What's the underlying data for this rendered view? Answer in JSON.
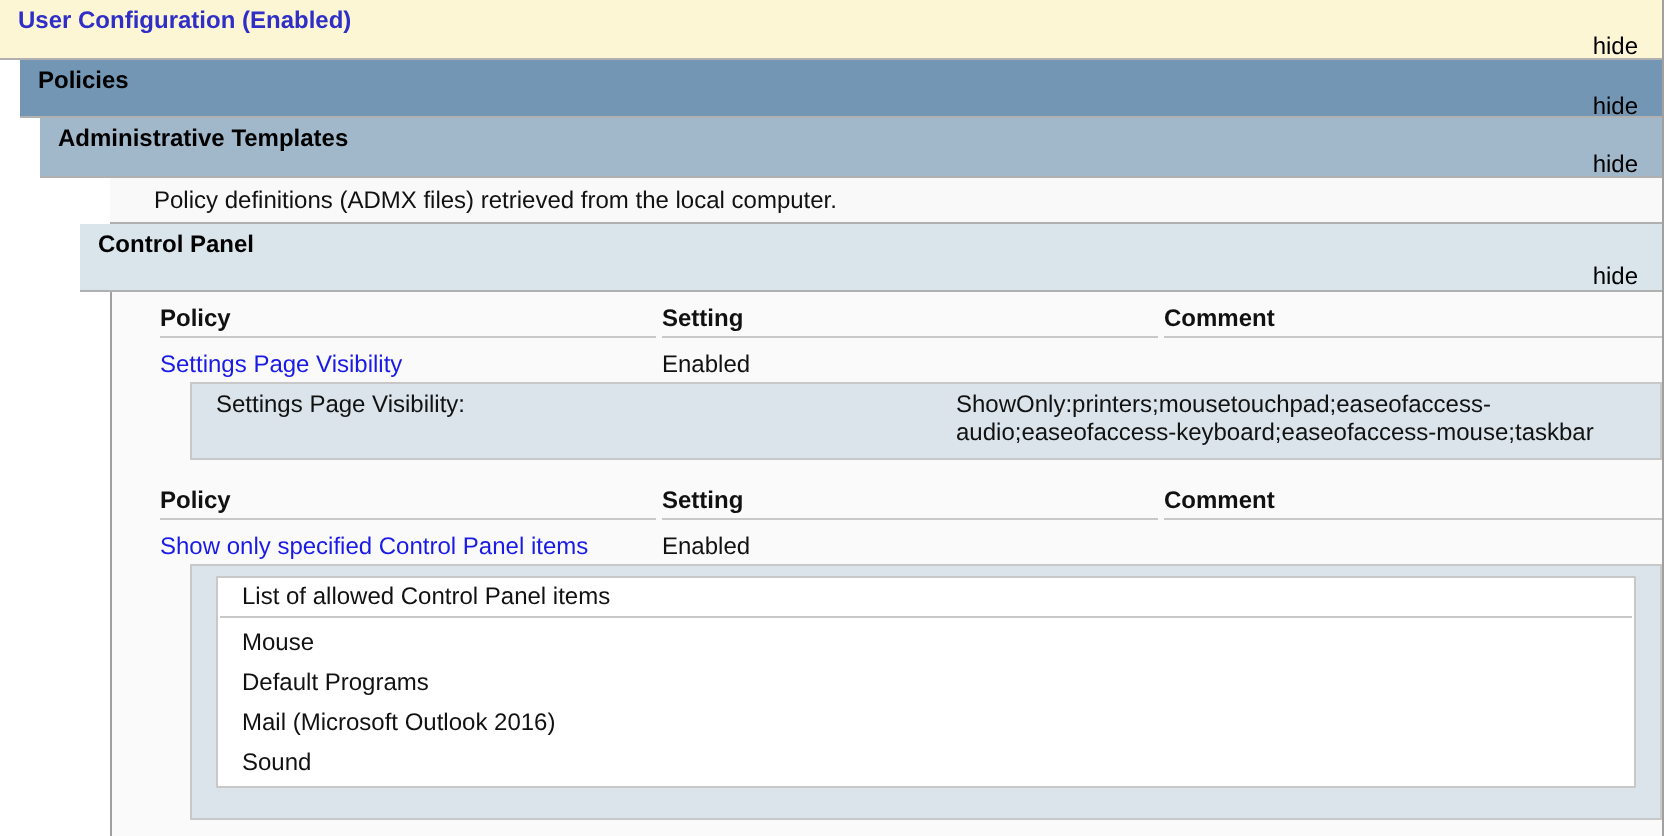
{
  "bars": [
    {
      "kind": "root",
      "title": "User Configuration (Enabled)",
      "hide": "hide"
    },
    {
      "kind": "level1",
      "title": "Policies",
      "hide": "hide"
    },
    {
      "kind": "level2",
      "title": "Administrative Templates",
      "hide": "hide"
    }
  ],
  "description": "Policy definitions (ADMX files) retrieved from the local computer.",
  "category": {
    "title": "Control Panel",
    "hide": "hide"
  },
  "policies": [
    {
      "columns": [
        "Policy",
        "Setting",
        "Comment"
      ],
      "name": "Settings Page Visibility",
      "setting": "Enabled",
      "detail": {
        "kind": "value",
        "label": "Settings Page Visibility:",
        "value": "ShowOnly:printers;mousetouchpad;easeofaccess-audio;easeofaccess-keyboard;easeofaccess-mouse;taskbar"
      }
    },
    {
      "columns": [
        "Policy",
        "Setting",
        "Comment"
      ],
      "name": "Show only specified Control Panel items",
      "setting": "Enabled",
      "detail": {
        "kind": "list",
        "heading": "List of allowed Control Panel items",
        "items": [
          "Mouse",
          "Default Programs",
          "Mail (Microsoft Outlook 2016)",
          "Sound"
        ]
      }
    }
  ]
}
